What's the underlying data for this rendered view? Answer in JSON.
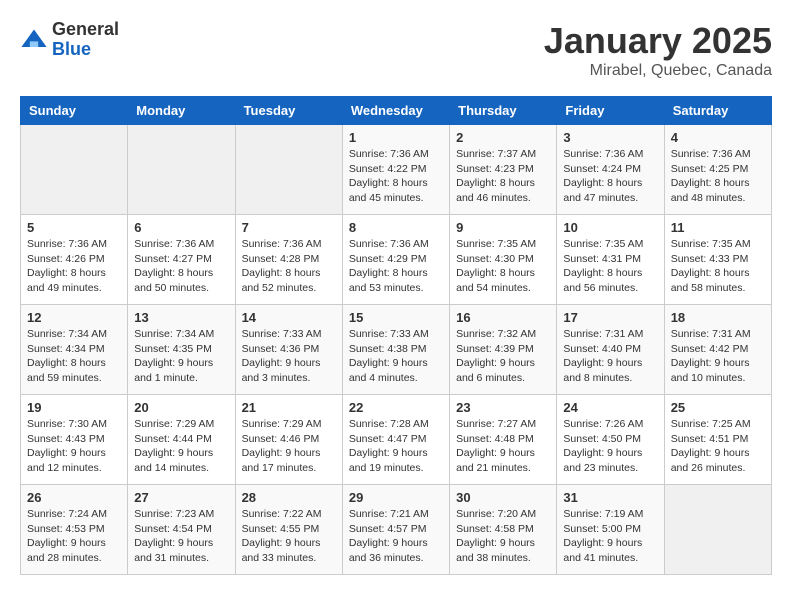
{
  "header": {
    "logo_general": "General",
    "logo_blue": "Blue",
    "title": "January 2025",
    "subtitle": "Mirabel, Quebec, Canada"
  },
  "weekdays": [
    "Sunday",
    "Monday",
    "Tuesday",
    "Wednesday",
    "Thursday",
    "Friday",
    "Saturday"
  ],
  "weeks": [
    [
      {
        "day": "",
        "info": ""
      },
      {
        "day": "",
        "info": ""
      },
      {
        "day": "",
        "info": ""
      },
      {
        "day": "1",
        "info": "Sunrise: 7:36 AM\nSunset: 4:22 PM\nDaylight: 8 hours\nand 45 minutes."
      },
      {
        "day": "2",
        "info": "Sunrise: 7:37 AM\nSunset: 4:23 PM\nDaylight: 8 hours\nand 46 minutes."
      },
      {
        "day": "3",
        "info": "Sunrise: 7:36 AM\nSunset: 4:24 PM\nDaylight: 8 hours\nand 47 minutes."
      },
      {
        "day": "4",
        "info": "Sunrise: 7:36 AM\nSunset: 4:25 PM\nDaylight: 8 hours\nand 48 minutes."
      }
    ],
    [
      {
        "day": "5",
        "info": "Sunrise: 7:36 AM\nSunset: 4:26 PM\nDaylight: 8 hours\nand 49 minutes."
      },
      {
        "day": "6",
        "info": "Sunrise: 7:36 AM\nSunset: 4:27 PM\nDaylight: 8 hours\nand 50 minutes."
      },
      {
        "day": "7",
        "info": "Sunrise: 7:36 AM\nSunset: 4:28 PM\nDaylight: 8 hours\nand 52 minutes."
      },
      {
        "day": "8",
        "info": "Sunrise: 7:36 AM\nSunset: 4:29 PM\nDaylight: 8 hours\nand 53 minutes."
      },
      {
        "day": "9",
        "info": "Sunrise: 7:35 AM\nSunset: 4:30 PM\nDaylight: 8 hours\nand 54 minutes."
      },
      {
        "day": "10",
        "info": "Sunrise: 7:35 AM\nSunset: 4:31 PM\nDaylight: 8 hours\nand 56 minutes."
      },
      {
        "day": "11",
        "info": "Sunrise: 7:35 AM\nSunset: 4:33 PM\nDaylight: 8 hours\nand 58 minutes."
      }
    ],
    [
      {
        "day": "12",
        "info": "Sunrise: 7:34 AM\nSunset: 4:34 PM\nDaylight: 8 hours\nand 59 minutes."
      },
      {
        "day": "13",
        "info": "Sunrise: 7:34 AM\nSunset: 4:35 PM\nDaylight: 9 hours\nand 1 minute."
      },
      {
        "day": "14",
        "info": "Sunrise: 7:33 AM\nSunset: 4:36 PM\nDaylight: 9 hours\nand 3 minutes."
      },
      {
        "day": "15",
        "info": "Sunrise: 7:33 AM\nSunset: 4:38 PM\nDaylight: 9 hours\nand 4 minutes."
      },
      {
        "day": "16",
        "info": "Sunrise: 7:32 AM\nSunset: 4:39 PM\nDaylight: 9 hours\nand 6 minutes."
      },
      {
        "day": "17",
        "info": "Sunrise: 7:31 AM\nSunset: 4:40 PM\nDaylight: 9 hours\nand 8 minutes."
      },
      {
        "day": "18",
        "info": "Sunrise: 7:31 AM\nSunset: 4:42 PM\nDaylight: 9 hours\nand 10 minutes."
      }
    ],
    [
      {
        "day": "19",
        "info": "Sunrise: 7:30 AM\nSunset: 4:43 PM\nDaylight: 9 hours\nand 12 minutes."
      },
      {
        "day": "20",
        "info": "Sunrise: 7:29 AM\nSunset: 4:44 PM\nDaylight: 9 hours\nand 14 minutes."
      },
      {
        "day": "21",
        "info": "Sunrise: 7:29 AM\nSunset: 4:46 PM\nDaylight: 9 hours\nand 17 minutes."
      },
      {
        "day": "22",
        "info": "Sunrise: 7:28 AM\nSunset: 4:47 PM\nDaylight: 9 hours\nand 19 minutes."
      },
      {
        "day": "23",
        "info": "Sunrise: 7:27 AM\nSunset: 4:48 PM\nDaylight: 9 hours\nand 21 minutes."
      },
      {
        "day": "24",
        "info": "Sunrise: 7:26 AM\nSunset: 4:50 PM\nDaylight: 9 hours\nand 23 minutes."
      },
      {
        "day": "25",
        "info": "Sunrise: 7:25 AM\nSunset: 4:51 PM\nDaylight: 9 hours\nand 26 minutes."
      }
    ],
    [
      {
        "day": "26",
        "info": "Sunrise: 7:24 AM\nSunset: 4:53 PM\nDaylight: 9 hours\nand 28 minutes."
      },
      {
        "day": "27",
        "info": "Sunrise: 7:23 AM\nSunset: 4:54 PM\nDaylight: 9 hours\nand 31 minutes."
      },
      {
        "day": "28",
        "info": "Sunrise: 7:22 AM\nSunset: 4:55 PM\nDaylight: 9 hours\nand 33 minutes."
      },
      {
        "day": "29",
        "info": "Sunrise: 7:21 AM\nSunset: 4:57 PM\nDaylight: 9 hours\nand 36 minutes."
      },
      {
        "day": "30",
        "info": "Sunrise: 7:20 AM\nSunset: 4:58 PM\nDaylight: 9 hours\nand 38 minutes."
      },
      {
        "day": "31",
        "info": "Sunrise: 7:19 AM\nSunset: 5:00 PM\nDaylight: 9 hours\nand 41 minutes."
      },
      {
        "day": "",
        "info": ""
      }
    ]
  ]
}
